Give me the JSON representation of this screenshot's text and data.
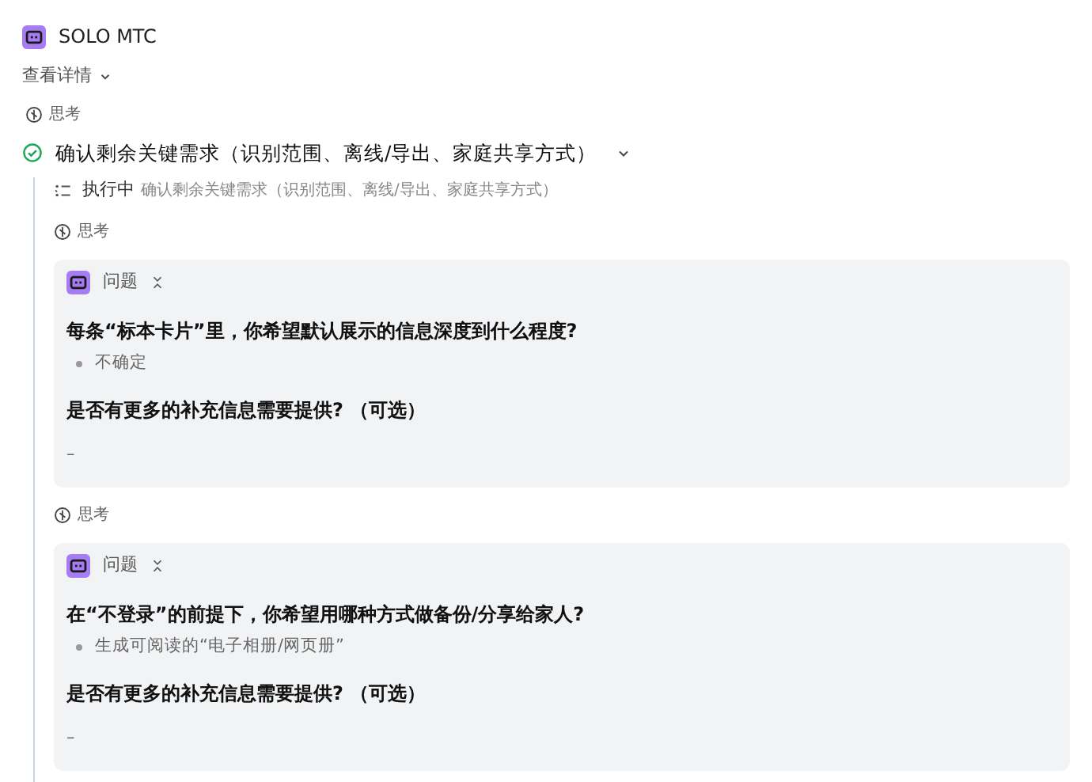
{
  "header": {
    "app_name": "SOLO MTC"
  },
  "details_toggle": {
    "label": "查看详情"
  },
  "thinking": {
    "label": "思考"
  },
  "task": {
    "title": "确认剩余关键需求（识别范围、离线/导出、家庭共享方式）",
    "done": true,
    "expanded": true,
    "items": [
      {
        "kind": "status",
        "status": "执行中",
        "text": "确认剩余关键需求（识别范围、离线/导出、家庭共享方式）"
      },
      {
        "kind": "thinking",
        "label": "思考"
      },
      {
        "kind": "question_card",
        "title": "问题",
        "questions": [
          {
            "kind": "choice",
            "text": "每条“标本卡片”里，你希望默认展示的信息深度到什么程度?",
            "answer": "不确定"
          },
          {
            "kind": "free_text",
            "text": "是否有更多的补充信息需要提供? （可选）",
            "answer": "–"
          }
        ]
      },
      {
        "kind": "thinking",
        "label": "思考"
      },
      {
        "kind": "question_card",
        "title": "问题",
        "questions": [
          {
            "kind": "choice",
            "text": "在“不登录”的前提下，你希望用哪种方式做备份/分享给家人?",
            "answer": "生成可阅读的“电子相册/网页册”"
          },
          {
            "kind": "free_text",
            "text": "是否有更多的补充信息需要提供? （可选）",
            "answer": "–"
          }
        ]
      }
    ]
  }
}
